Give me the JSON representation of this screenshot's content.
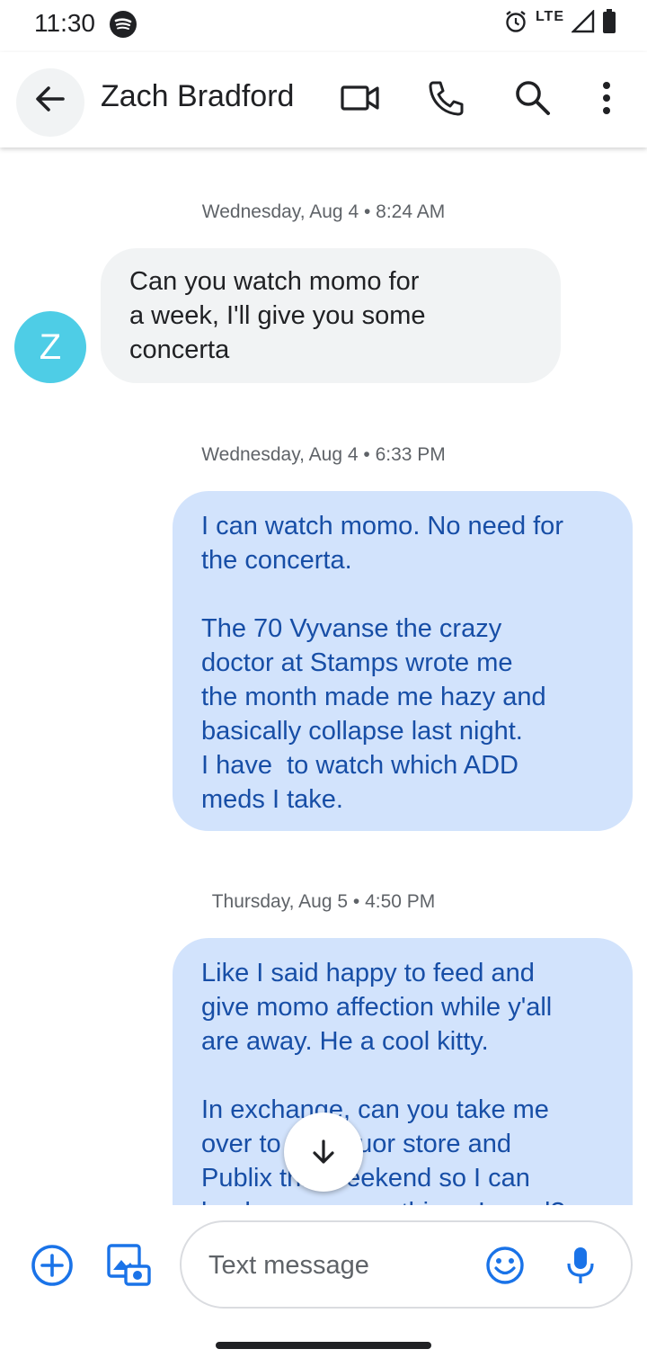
{
  "status_bar": {
    "time": "11:30",
    "network": "LTE"
  },
  "header": {
    "contact_name": "Zach Bradford",
    "icons": [
      "back-arrow-icon",
      "video-call-icon",
      "phone-icon",
      "search-icon",
      "more-vert-icon"
    ]
  },
  "conversation": {
    "avatar_letter": "Z",
    "avatar_color": "#4ecde6",
    "messages": [
      {
        "date": "Wednesday, Aug 4 • 8:24 AM",
        "direction": "incoming",
        "text": "Can you watch momo for\na week, I'll give you some\nconcerta"
      },
      {
        "date": "Wednesday, Aug 4 • 6:33 PM",
        "direction": "outgoing",
        "text": "I can watch momo. No need for\nthe concerta.\n\nThe 70 Vyvanse the crazy\ndoctor at Stamps wrote me\nthe month made me hazy and\nbasically collapse last night.\nI have  to watch which ADD\nmeds I take."
      },
      {
        "date": "Thursday, Aug 5 • 4:50 PM",
        "direction": "outgoing",
        "text": "Like I said happy to feed and\ngive momo affection while y'all\nare away. He a cool kitty.\n\nIn exchange, can you take me\nover to the liquor store and\nPublix this weekend so I can\nload up on some things I need?"
      }
    ]
  },
  "composer": {
    "placeholder": "Text message",
    "accent_color": "#1a73e8"
  }
}
